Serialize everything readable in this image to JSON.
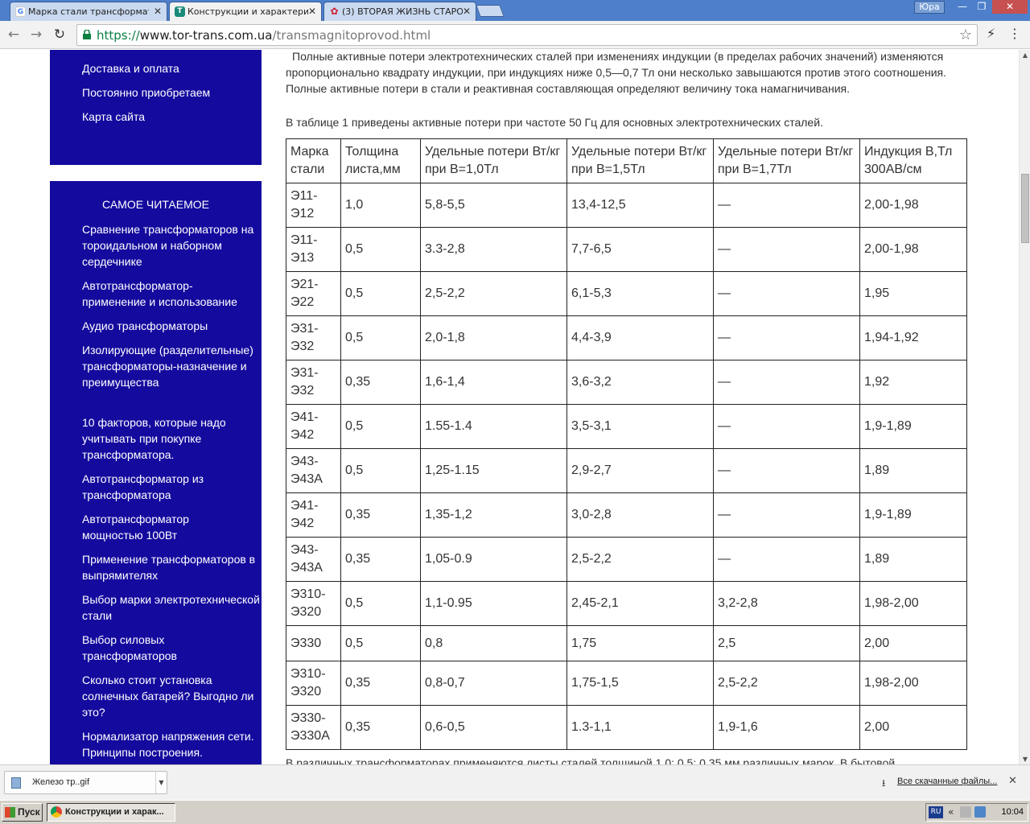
{
  "browser": {
    "tabs": [
      {
        "title": "Марка стали трансформато",
        "favicon": "google-favicon",
        "favicon_color": "#4285f4",
        "favicon_letter": "G",
        "active": false
      },
      {
        "title": "Конструкции и характерис",
        "favicon": "site-favicon",
        "favicon_color": "#1a8a7a",
        "favicon_letter": "Т",
        "active": true
      },
      {
        "title": "(3) ВТОРАЯ ЖИЗНЬ СТАРО",
        "favicon": "huawei-favicon",
        "favicon_color": "#cf1f2e",
        "favicon_letter": "✿",
        "active": false
      }
    ],
    "user": "Юра",
    "window_buttons": {
      "minimize": "—",
      "restore": "❐",
      "close": "✕"
    },
    "url": {
      "scheme": "https://",
      "host": "www.tor-trans.com.ua",
      "path": "/transmagnitoprovod.html"
    }
  },
  "sidebar": {
    "top_links": [
      "Доставка и оплата",
      "Постоянно приобретаем",
      "Карта сайта"
    ],
    "section_title": "САМОЕ ЧИТАЕМОЕ",
    "popular": [
      "Сравнение трансформаторов на тороидальном и наборном сердечнике",
      "Автотрансформатор-применение и использование",
      "Аудио трансформаторы",
      "Изолирующие (разделительные) трансформаторы-назначение и преимущества",
      "10 факторов, которые надо учитывать при покупке трансформатора.",
      "Автотрансформатор из трансформатора",
      "Автотрансформатор мощностью 100Вт",
      "Применение трансформаторов в выпрямителях",
      "Выбор марки электротехнической стали",
      "Выбор силовых трансформаторов",
      "Сколько стоит установка солнечных батарей? Выгодно ли это?",
      "Нормализатор напряжения сети. Принципы построения."
    ]
  },
  "content": {
    "intro": "Полные активные потери электротехнических сталей при изменениях индукции (в пределах рабочих значений) изменяются пропорционально квадрату индукции, при индукциях ниже 0,5—0,7 Тл они несколько завышаются против этого соотношения. Полные активные потери в стали и реактивная составляющая определяют величину тока намагничивания.",
    "intro2": "В таблице 1 приведены активные потери при частоте 50 Гц для основных электротехнических сталей.",
    "footer_cut": "В различных трансформаторах применяются листы сталей толщиной 1,0; 0,5; 0,35 мм различных марок. В бытовой"
  },
  "table": {
    "headers": [
      "Марка стали",
      "Толщина листа,мм",
      "Удельные потери Вт/кг при В=1,0Тл",
      "Удельные потери Вт/кг при В=1,5Тл",
      "Удельные потери Вт/кг при В=1,7Тл",
      "Индукция В,Тл 300АВ/см"
    ],
    "rows": [
      [
        "Э11-Э12",
        "1,0",
        "5,8-5,5",
        "13,4-12,5",
        "—",
        "2,00-1,98"
      ],
      [
        "Э11-Э13",
        "0,5",
        "3.3-2,8",
        "7,7-6,5",
        "—",
        "2,00-1,98"
      ],
      [
        "Э21-Э22",
        "0,5",
        "2,5-2,2",
        "6,1-5,3",
        "—",
        "1,95"
      ],
      [
        "Э31-Э32",
        "0,5",
        "2,0-1,8",
        "4,4-3,9",
        "—",
        "1,94-1,92"
      ],
      [
        "Э31-Э32",
        "0,35",
        "1,6-1,4",
        "3,6-3,2",
        "—",
        "1,92"
      ],
      [
        "Э41-Э42",
        "0,5",
        "1.55-1.4",
        "3,5-3,1",
        "—",
        "1,9-1,89"
      ],
      [
        "Э43-Э43А",
        "0,5",
        "1,25-1.15",
        "2,9-2,7",
        "—",
        "1,89"
      ],
      [
        "Э41-Э42",
        "0,35",
        "1,35-1,2",
        "3,0-2,8",
        "—",
        "1,9-1,89"
      ],
      [
        "Э43-Э43А",
        "0,35",
        "1,05-0.9",
        "2,5-2,2",
        "—",
        "1,89"
      ],
      [
        "Э310-Э320",
        "0,5",
        "1,1-0.95",
        "2,45-2,1",
        "3,2-2,8",
        "1,98-2,00"
      ],
      [
        "Э330",
        "0,5",
        "0,8",
        "1,75",
        "2,5",
        "2,00"
      ],
      [
        "Э310-Э320",
        "0,35",
        "0,8-0,7",
        "1,75-1,5",
        "2,5-2,2",
        "1,98-2,00"
      ],
      [
        "Э330-Э330А",
        "0,35",
        "0,6-0,5",
        "1.3-1,1",
        "1,9-1,6",
        "2,00"
      ]
    ]
  },
  "downloads": {
    "file": "Железо тр..gif",
    "show_all": "Все скачанные файлы..."
  },
  "taskbar": {
    "start": "Пуск",
    "active_window": "Конструкции и харак...",
    "lang": "RU",
    "time": "10:04"
  },
  "colors": {
    "sidebar_bg": "#140a9e",
    "tab_strip": "#4d7fcb"
  }
}
